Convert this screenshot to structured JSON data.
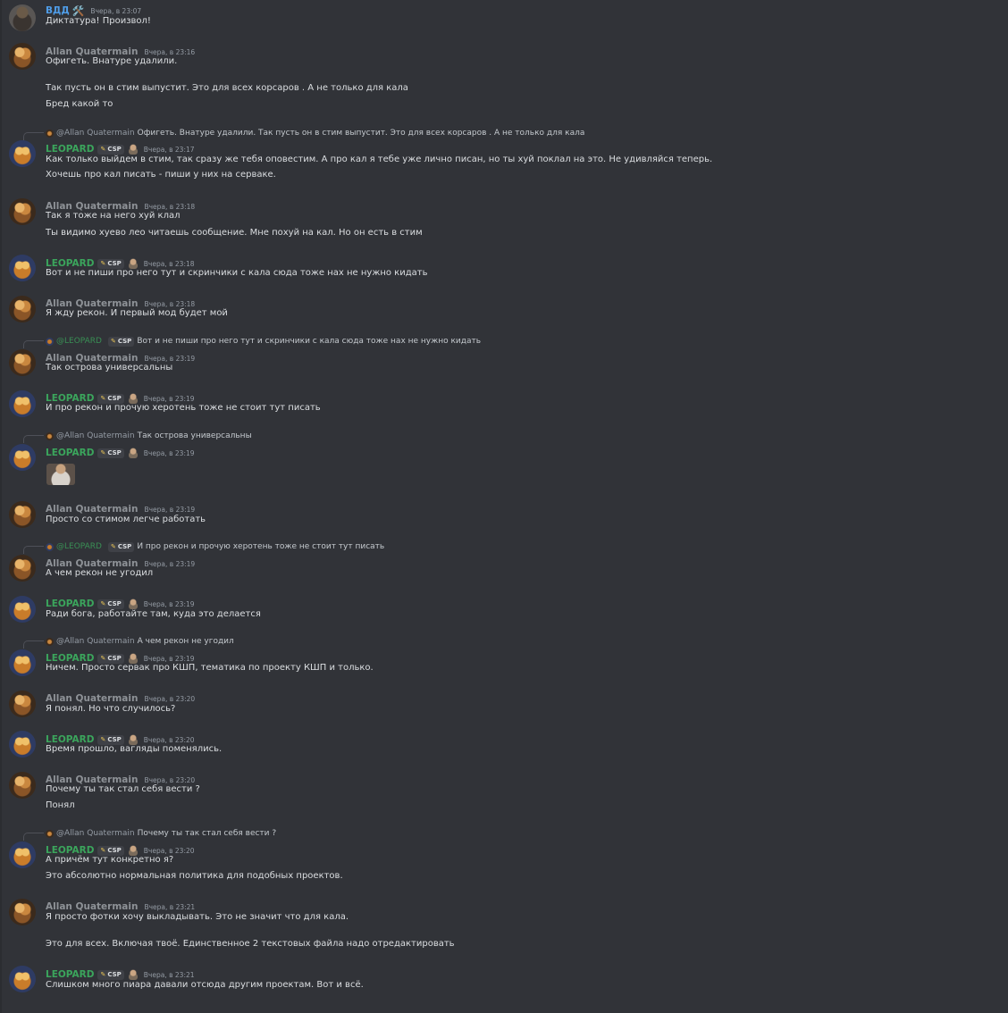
{
  "app": "Discord",
  "messages": [
    {
      "author": "ВДД",
      "emoji": "🛠️",
      "time": "Вчера, в 23:07",
      "avatar": "vdd",
      "lines": [
        "Диктатура! Произвол!"
      ]
    },
    {
      "author": "Allan Quatermain",
      "time": "Вчера, в 23:16",
      "avatar": "allan",
      "lines": [
        "Офигеть. Внатуре удалили.",
        "Так пусть он в стим выпустит. Это для всех корсаров . А не только для кала",
        "Бред какой то"
      ]
    },
    {
      "author": "LEOPARD",
      "tag": "CSP",
      "time": "Вчера, в 23:17",
      "avatar": "leo",
      "reply": {
        "author": "@Allan Quatermain",
        "text": "Офигеть. Внатуре удалили.  Так пусть он в стим выпустит. Это для всех корсаров . А не только для кала"
      },
      "lines": [
        "Как только выйдем в стим, так сразу же тебя оповестим. А про кал я тебе уже лично писан, но ты хуй поклал на это. Не удивляйся теперь.",
        "Хочешь про кал писать - пиши у них на серваке."
      ]
    },
    {
      "author": "Allan Quatermain",
      "time": "Вчера, в 23:18",
      "avatar": "allan",
      "lines": [
        "Так я тоже на него хуй клал",
        "Ты видимо хуево лео читаешь сообщение. Мне похуй на кал. Но он есть в стим"
      ]
    },
    {
      "author": "LEOPARD",
      "tag": "CSP",
      "time": "Вчера, в 23:18",
      "avatar": "leo",
      "lines": [
        "Вот и не пиши про него тут и скринчики с кала сюда тоже нах не нужно кидать"
      ]
    },
    {
      "author": "Allan Quatermain",
      "time": "Вчера, в 23:18",
      "avatar": "allan",
      "lines": [
        "Я жду рекон. И первый мод будет мой"
      ]
    },
    {
      "author": "Allan Quatermain",
      "time": "Вчера, в 23:19",
      "avatar": "allan",
      "reply": {
        "author": "@LEOPARD",
        "tag": "CSP",
        "text": "Вот и не пиши про него тут и скринчики с кала сюда тоже нах не нужно кидать"
      },
      "lines": [
        "Так острова универсальны"
      ]
    },
    {
      "author": "LEOPARD",
      "tag": "CSP",
      "time": "Вчера, в 23:19",
      "avatar": "leo",
      "lines": [
        "И про рекон и прочую херотень тоже не стоит тут писать"
      ]
    },
    {
      "author": "LEOPARD",
      "tag": "CSP",
      "time": "Вчера, в 23:19",
      "avatar": "leo",
      "reply": {
        "author": "@Allan Quatermain",
        "text": "Так острова универсальны"
      },
      "sticker": "sticker-image",
      "lines": []
    },
    {
      "author": "Allan Quatermain",
      "time": "Вчера, в 23:19",
      "avatar": "allan",
      "lines": [
        "Просто со стимом легче работать"
      ]
    },
    {
      "author": "Allan Quatermain",
      "time": "Вчера, в 23:19",
      "avatar": "allan",
      "reply": {
        "author": "@LEOPARD",
        "tag": "CSP",
        "text": "И про рекон и прочую херотень тоже не стоит тут писать"
      },
      "lines": [
        "А чем рекон не угодил"
      ]
    },
    {
      "author": "LEOPARD",
      "tag": "CSP",
      "time": "Вчера, в 23:19",
      "avatar": "leo",
      "lines": [
        "Ради бога, работайте там, куда это делается"
      ]
    },
    {
      "author": "LEOPARD",
      "tag": "CSP",
      "time": "Вчера, в 23:19",
      "avatar": "leo",
      "reply": {
        "author": "@Allan Quatermain",
        "text": "А чем рекон не угодил"
      },
      "lines": [
        "Ничем. Просто сервак про КШП, тематика по проекту КШП и только."
      ]
    },
    {
      "author": "Allan Quatermain",
      "time": "Вчера, в 23:20",
      "avatar": "allan",
      "lines": [
        "Я понял. Но что случилось?"
      ]
    },
    {
      "author": "LEOPARD",
      "tag": "CSP",
      "time": "Вчера, в 23:20",
      "avatar": "leo",
      "lines": [
        "Время прошло, вагляды поменялись."
      ]
    },
    {
      "author": "Allan Quatermain",
      "time": "Вчера, в 23:20",
      "avatar": "allan",
      "lines": [
        "Почему ты так стал себя вести ?",
        "Понял"
      ]
    },
    {
      "author": "LEOPARD",
      "tag": "CSP",
      "time": "Вчера, в 23:20",
      "avatar": "leo",
      "reply": {
        "author": "@Allan Quatermain",
        "text": "Почему ты так стал себя вести ?"
      },
      "lines": [
        "А причём тут конкретно я?",
        "Это абсолютно нормальная политика для подобных проектов."
      ]
    },
    {
      "author": "Allan Quatermain",
      "time": "Вчера, в 23:21",
      "avatar": "allan",
      "lines": [
        "Я просто фотки хочу выкладывать. Это не значит что для кала.",
        "Это для всех. Включая твоё. Единственное 2 текстовых файла надо отредактировать"
      ]
    },
    {
      "author": "LEOPARD",
      "tag": "CSP",
      "time": "Вчера, в 23:21",
      "avatar": "leo",
      "lines": [
        "Слишком много пиара давали отсюда другим проектам. Вот и всё."
      ]
    }
  ]
}
